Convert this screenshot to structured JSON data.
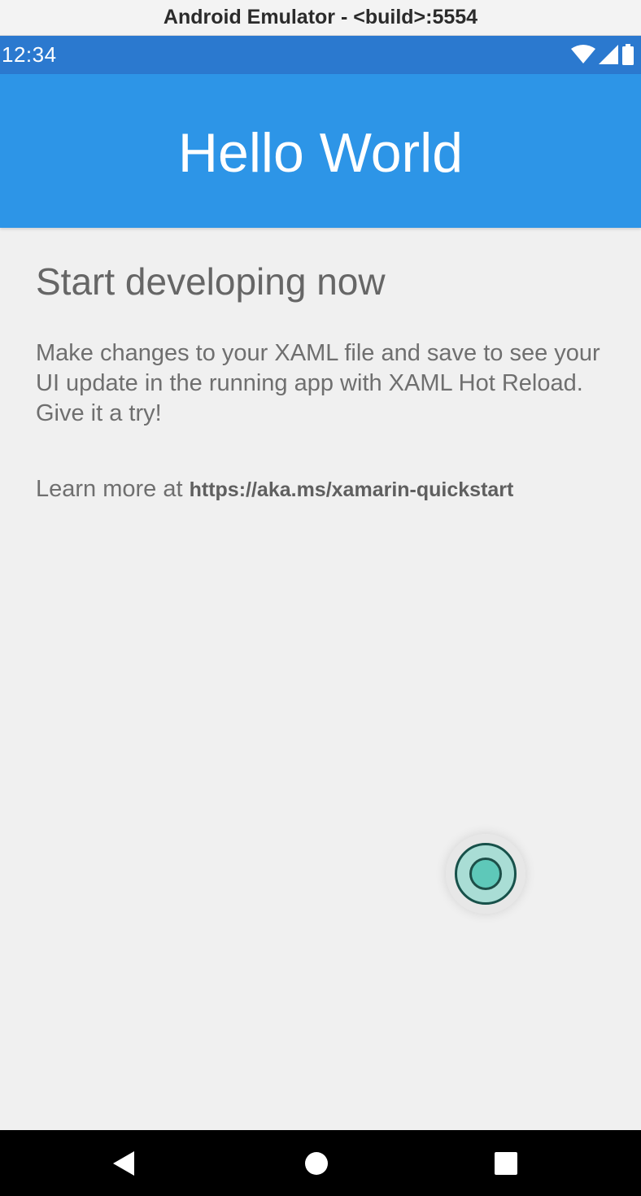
{
  "window": {
    "title": "Android Emulator - <build>:5554"
  },
  "statusbar": {
    "time": "12:34",
    "icons": [
      "wifi-icon",
      "cell-signal-icon",
      "battery-icon"
    ]
  },
  "toolbar": {
    "title": "Hello World"
  },
  "main": {
    "heading": "Start developing now",
    "body": "Make changes to your XAML file and save to see your UI update in the running app with XAML Hot Reload. Give it a try!",
    "learn_more_prefix": "Learn more at ",
    "learn_more_link": "https://aka.ms/xamarin-quickstart"
  },
  "navbar": {
    "buttons": [
      "back-icon",
      "home-icon",
      "recents-icon"
    ]
  },
  "colors": {
    "statusbar": "#2b79cf",
    "toolbar": "#2d95e7",
    "background": "#f0f0f0",
    "text": "#6f6f6f",
    "fab_fill": "#5ec8b9"
  }
}
